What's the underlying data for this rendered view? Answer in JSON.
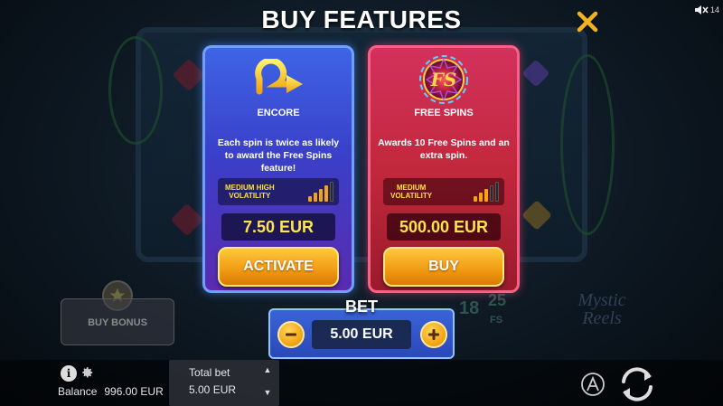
{
  "title": "BUY FEATURES",
  "sound": {
    "icon": "speaker-muted-icon",
    "label": "14"
  },
  "close": {
    "icon": "close-x-icon",
    "color": "#f2b21b"
  },
  "cards": [
    {
      "id": "encore",
      "icon": "encore-arrow-icon",
      "name": "ENCORE",
      "description": "Each spin is twice as likely to award the Free Spins feature!",
      "volatility_label": "MEDIUM HIGH\nVOLATILITY",
      "volatility_level": 4,
      "volatility_max": 5,
      "price": "7.50 EUR",
      "action": "ACTIVATE",
      "color": "#3a50d8"
    },
    {
      "id": "free-spins",
      "icon": "fs-badge-icon",
      "name": "FREE SPINS",
      "description": "Awards 10 Free Spins and an extra spin.",
      "volatility_label": "MEDIUM\nVOLATILITY",
      "volatility_level": 3,
      "volatility_max": 5,
      "price": "500.00 EUR",
      "action": "BUY",
      "color": "#c52a45"
    }
  ],
  "bet": {
    "label": "BET",
    "value": "5.00 EUR",
    "decrease_icon": "minus-icon",
    "increase_icon": "plus-icon"
  },
  "background": {
    "buy_bonus": "BUY BONUS",
    "logo_line1": "Mystic",
    "logo_line2": "Reels",
    "fs_numbers": [
      "18",
      "25",
      "FS"
    ]
  },
  "bottom": {
    "balance_label": "Balance",
    "balance_value": "996.00 EUR",
    "total_bet_label": "Total bet",
    "total_bet_value": "5.00 EUR"
  }
}
